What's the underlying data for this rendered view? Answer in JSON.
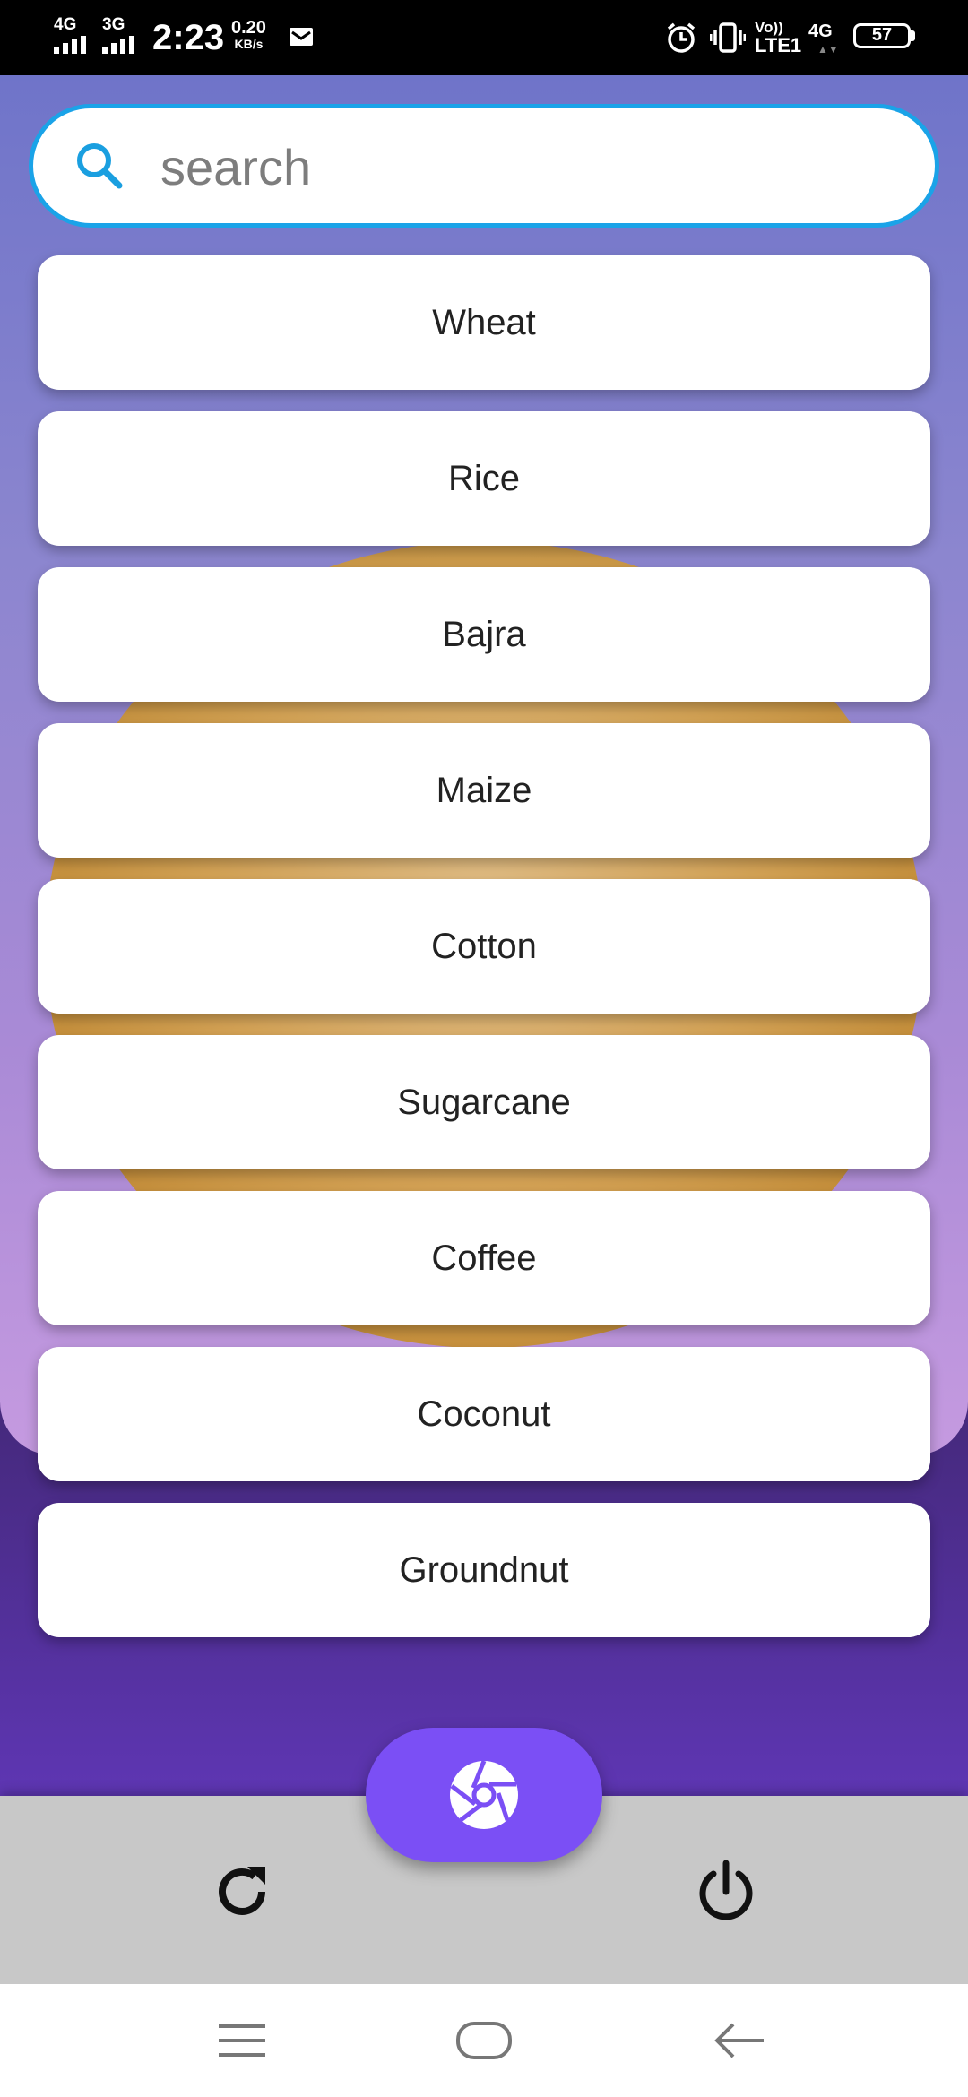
{
  "status_bar": {
    "network_1": "4G",
    "network_2": "3G",
    "time": "2:23",
    "speed_value": "0.20",
    "speed_unit": "KB/s",
    "volte_top": "Vo))",
    "volte_bottom": "LTE1",
    "data_network": "4G",
    "battery_level": "57",
    "icons": [
      "mail-icon",
      "alarm-icon",
      "vibrate-icon"
    ]
  },
  "search": {
    "placeholder": "search",
    "value": "",
    "icon": "search-icon",
    "border_color": "#1aa3e8"
  },
  "suggestions": [
    "Wheat",
    "Rice",
    "Bajra",
    "Maize",
    "Cotton",
    "Sugarcane",
    "Coffee",
    "Coconut",
    "Groundnut"
  ],
  "bottom_bar": {
    "left_icon": "refresh-icon",
    "center_icon": "camera-aperture-icon",
    "right_icon": "power-icon",
    "fab_color": "#7b4ff5"
  },
  "system_nav": {
    "icons": [
      "menu-icon",
      "home-icon",
      "back-icon"
    ]
  }
}
